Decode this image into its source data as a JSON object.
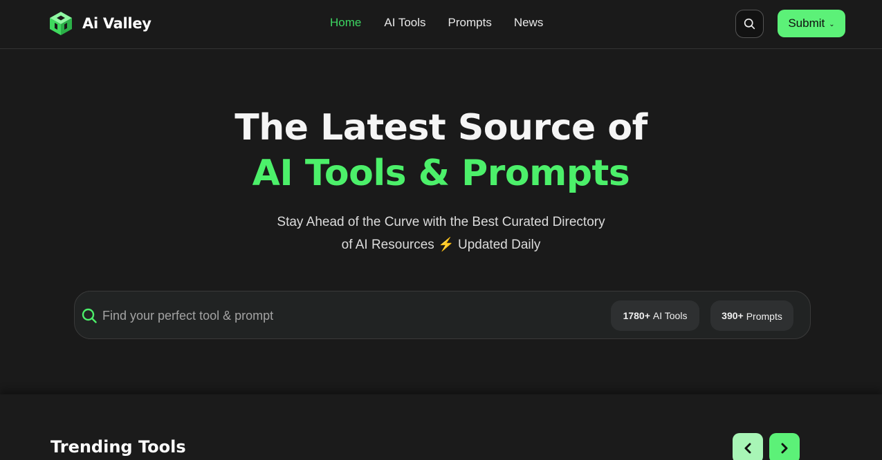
{
  "brand": {
    "name": "Ai Valley",
    "accent": "#4cf06a"
  },
  "nav": {
    "items": [
      {
        "label": "Home",
        "active": true
      },
      {
        "label": "AI Tools",
        "active": false
      },
      {
        "label": "Prompts",
        "active": false
      },
      {
        "label": "News",
        "active": false
      }
    ]
  },
  "header": {
    "search_icon": "search-icon",
    "submit_label": "Submit"
  },
  "hero": {
    "title_line1": "The Latest Source of",
    "title_line2": "AI Tools & Prompts",
    "subtitle_line1": "Stay Ahead of the Curve with the Best Curated Directory",
    "subtitle_line2": "of AI Resources ⚡ Updated Daily"
  },
  "search": {
    "placeholder": "Find your perfect tool & prompt",
    "value": "",
    "stats": {
      "tools_count": "1780+",
      "tools_label": "AI Tools",
      "prompts_count": "390+",
      "prompts_label": "Prompts"
    }
  },
  "trending": {
    "title": "Trending Tools",
    "prev_icon": "chevron-left-icon",
    "next_icon": "chevron-right-icon"
  }
}
